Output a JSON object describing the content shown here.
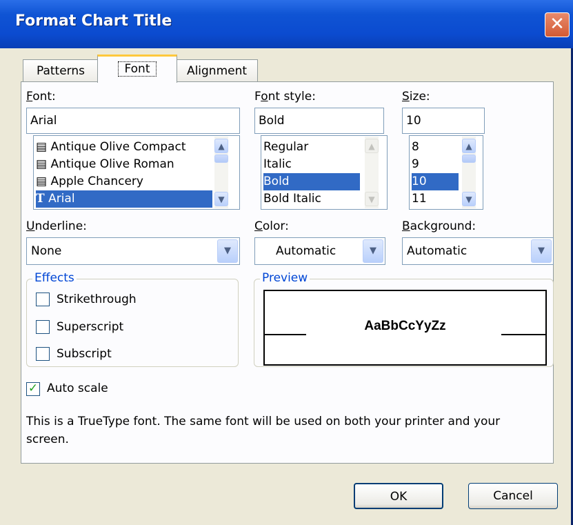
{
  "window": {
    "title": "Format Chart Title",
    "close_label": "✕"
  },
  "tabs": [
    {
      "label": "Patterns"
    },
    {
      "label": "Font"
    },
    {
      "label": "Alignment"
    }
  ],
  "font_section": {
    "label": "Font:",
    "value": "Arial",
    "items": [
      {
        "label": "Antique Olive Compact",
        "icon": "printer-font-icon"
      },
      {
        "label": "Antique Olive Roman",
        "icon": "printer-font-icon"
      },
      {
        "label": "Apple Chancery",
        "icon": "printer-font-icon"
      },
      {
        "label": "Arial",
        "icon": "truetype-font-icon"
      }
    ],
    "selected": "Arial"
  },
  "style_section": {
    "label": "Font style:",
    "value": "Bold",
    "items": [
      "Regular",
      "Italic",
      "Bold",
      "Bold Italic"
    ],
    "selected": "Bold"
  },
  "size_section": {
    "label": "Size:",
    "value": "10",
    "items": [
      "8",
      "9",
      "10",
      "11"
    ],
    "selected": "10"
  },
  "underline": {
    "label": "Underline:",
    "value": "None"
  },
  "color": {
    "label": "Color:",
    "value": "Automatic"
  },
  "background": {
    "label": "Background:",
    "value": "Automatic"
  },
  "effects": {
    "title": "Effects",
    "strikethrough": {
      "label": "Strikethrough",
      "checked": false
    },
    "superscript": {
      "label": "Superscript",
      "checked": false
    },
    "subscript": {
      "label": "Subscript",
      "checked": false
    }
  },
  "preview": {
    "title": "Preview",
    "sample": "AaBbCcYyZz"
  },
  "auto_scale": {
    "label": "Auto scale",
    "checked": true
  },
  "info_text": "This is a TrueType font.  The same font will be used on both your printer and your screen.",
  "buttons": {
    "ok": "OK",
    "cancel": "Cancel"
  },
  "colors": {
    "title_bar": "#0b4bd0",
    "selection": "#316ac5",
    "group_title": "#0046d5",
    "tab_highlight": "#ffc83c"
  }
}
